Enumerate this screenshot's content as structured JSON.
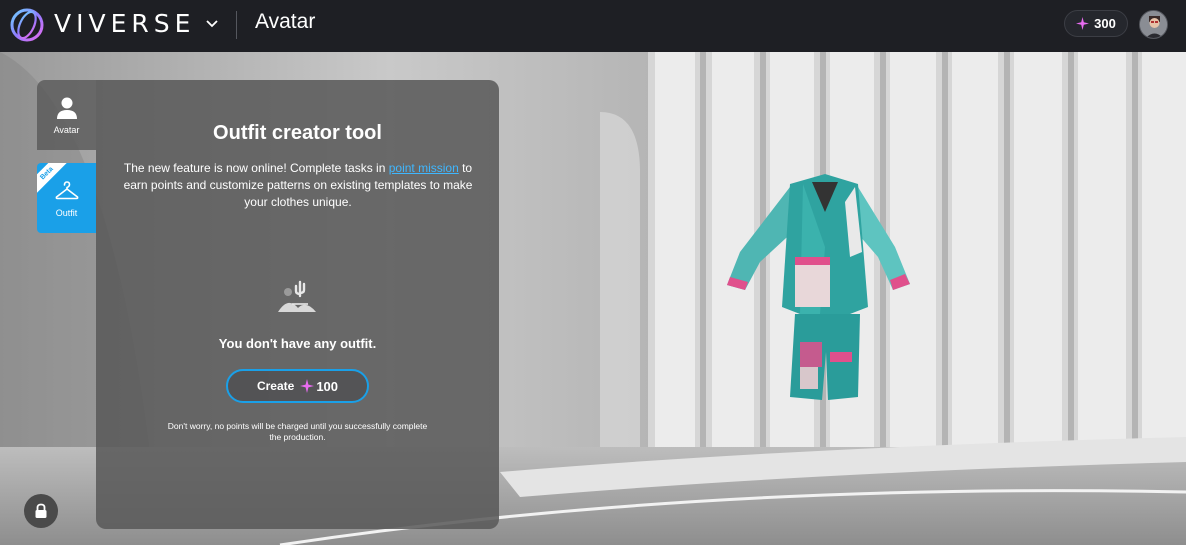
{
  "header": {
    "brand": "VIVERSE",
    "page_title": "Avatar",
    "points": "300",
    "icons": {
      "logo": "viverse-logo-icon",
      "chevron": "chevron-down-icon",
      "points": "sparkle-points-icon",
      "profile": "profile-avatar-icon"
    }
  },
  "sidebar": {
    "tabs": [
      {
        "label": "Avatar",
        "icon": "person-icon"
      },
      {
        "label": "Outfit",
        "icon": "hanger-icon",
        "badge": "Beta"
      }
    ]
  },
  "panel": {
    "title": "Outfit creator tool",
    "description_before": "The new feature is now online! Complete tasks in ",
    "link_text": "point mission",
    "description_after": " to earn points and customize patterns on existing templates to make your clothes unique.",
    "empty_message": "You don't have any outfit.",
    "create_label": "Create",
    "create_cost": "100",
    "footnote": "Don't worry, no points will be charged until you successfully complete the production."
  },
  "colors": {
    "accent": "#1aa0e8",
    "topbar": "#1e1f24",
    "link": "#3fb7ff",
    "points_sparkle": "#e86cf0"
  }
}
